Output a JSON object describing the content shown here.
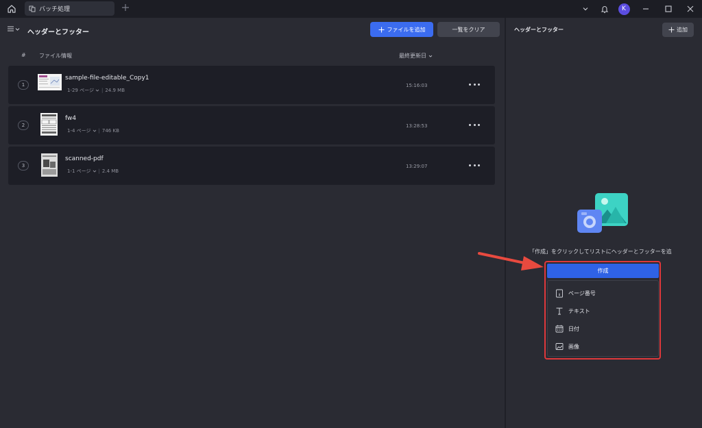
{
  "titlebar": {
    "tab_label": "バッチ処理",
    "avatar_letter": "K"
  },
  "left_panel": {
    "title": "ヘッダーとフッター",
    "add_file_label": "ファイルを追加",
    "clear_label": "一覧をクリア",
    "columns": {
      "num": "#",
      "info": "ファイル情報",
      "date": "最終更新日"
    },
    "files": [
      {
        "num": "1",
        "name": "sample-file-editable_Copy1",
        "pages": "1-29 ページ",
        "size": "24.9 MB",
        "time": "15:16:03"
      },
      {
        "num": "2",
        "name": "fw4",
        "pages": "1-4 ページ",
        "size": "746 KB",
        "time": "13:28:53"
      },
      {
        "num": "3",
        "name": "scanned-pdf",
        "pages": "1-1 ページ",
        "size": "2.4 MB",
        "time": "13:29:07"
      }
    ]
  },
  "right_panel": {
    "title": "ヘッダーとフッター",
    "add_label": "追加",
    "empty_message": "「作成」をクリックしてリストにヘッダーとフッターを追",
    "create_label": "作成",
    "menu_items": [
      {
        "label": "ページ番号",
        "icon": "page-number-icon"
      },
      {
        "label": "テキスト",
        "icon": "text-icon"
      },
      {
        "label": "日付",
        "icon": "calendar-icon"
      },
      {
        "label": "画像",
        "icon": "image-icon"
      }
    ]
  },
  "colors": {
    "accent": "#3b6cf0",
    "highlight": "#e0383b"
  }
}
